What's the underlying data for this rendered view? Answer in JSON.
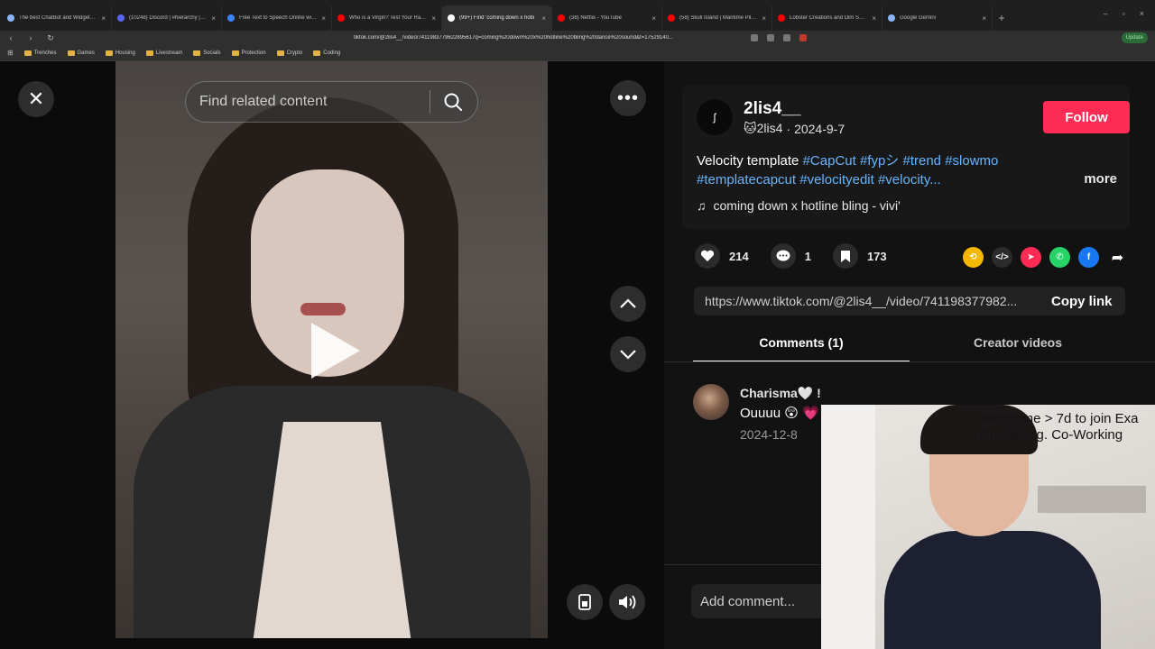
{
  "browser": {
    "tabs": [
      {
        "label": "The best ChatBot and Widgets for K…",
        "color": "#8ab4f8",
        "active": false
      },
      {
        "label": "(10248) Discord | #hierarchy | Exa",
        "color": "#5865f2",
        "active": false
      },
      {
        "label": "Free Text to Speech Online with Rea",
        "color": "#3b82f6",
        "active": false
      },
      {
        "label": "Who is a Virgin? Test Your Radar? (Fr",
        "color": "#ff0000",
        "active": false
      },
      {
        "label": "(99+) Find 'coming down x hotli",
        "color": "#ffffff",
        "active": true
      },
      {
        "label": "(38) Netflix - YouTube",
        "color": "#ff0000",
        "active": false
      },
      {
        "label": "(58) Skull Island | Maritime Pilot | Full",
        "color": "#ff0000",
        "active": false
      },
      {
        "label": "Lobster Creations and Dim Sum Tag",
        "color": "#ff0000",
        "active": false
      },
      {
        "label": "Google Gemini",
        "color": "#8ab4f8",
        "active": false
      }
    ],
    "url": "tiktok.com/@2lis4__/video/7411983779622895617q=coming%20down%20x%20hotline%20bling%20dance%20sound&t=17529140...",
    "update_label": "Update",
    "bookmarks": [
      "Trenches",
      "Games",
      "Housing",
      "Livestream",
      "Socials",
      "Protection",
      "Crypto",
      "Coding"
    ]
  },
  "video": {
    "search_placeholder": "Find related content"
  },
  "post": {
    "username": "2lis4__",
    "avatar_text": "ʃ",
    "nickname": "🐱2lis4",
    "separator": "·",
    "date": "2024-9-7",
    "follow_label": "Follow",
    "caption": "Velocity template",
    "hashtags_line1": [
      "#CapCut",
      "#fypシ",
      "#trend",
      "#slowmo"
    ],
    "hashtags_line2": [
      "#templatecapcut",
      "#velocityedit",
      "#velocity..."
    ],
    "more_label": "more",
    "music": "coming down x hotline bling - vivi'",
    "likes": "214",
    "comments": "1",
    "saves": "173",
    "link": "https://www.tiktok.com/@2lis4__/video/741198377982...",
    "copy_label": "Copy link",
    "share_colors": {
      "repost": "#f5b800",
      "embed": "#2b2b2b",
      "send": "#fe2c55",
      "whatsapp": "#25d366",
      "facebook": "#1877f2"
    }
  },
  "tabs": {
    "comments": "Comments (1)",
    "creator": "Creator videos"
  },
  "comment": {
    "name": "Charisma🤍 !",
    "text": "Ouuuu 😲 💗",
    "date": "2024-12-8"
  },
  "add_comment_placeholder": "Add comment...",
  "webcam": {
    "line1": "watchtime > 7d to join Exa",
    "line2": "Not talking. Co-Working"
  }
}
